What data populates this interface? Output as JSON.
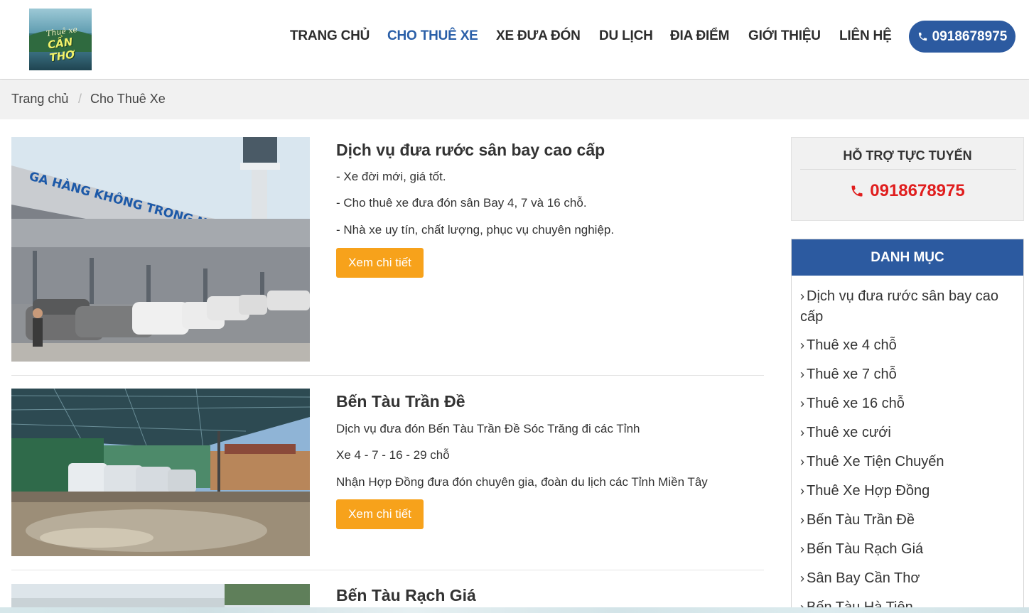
{
  "header": {
    "logo_text_line1": "Thuê xe",
    "logo_text_line2": "CẦN THƠ",
    "nav": [
      {
        "label": "TRANG CHỦ",
        "active": false
      },
      {
        "label": "CHO THUÊ XE",
        "active": true
      },
      {
        "label": "XE ĐƯA ĐÓN",
        "active": false
      },
      {
        "label": "DU LỊCH",
        "active": false
      },
      {
        "label": "ĐIA ĐIỂM",
        "active": false
      },
      {
        "label": "GIỚI THIỆU",
        "active": false
      },
      {
        "label": "LIÊN HỆ",
        "active": false
      }
    ],
    "phone": "0918678975"
  },
  "breadcrumb": {
    "home": "Trang chủ",
    "separator": "/",
    "current": "Cho Thuê Xe"
  },
  "articles": [
    {
      "title": "Dịch vụ đưa rước sân bay cao cấp",
      "lines": [
        "- Xe đời mới, giá tốt.",
        "- Cho thuê xe đưa đón sân Bay 4, 7 và 16 chỗ.",
        "- Nhà xe uy tín, chất lượng, phục vụ chuyên nghiệp."
      ],
      "button": "Xem chi tiết",
      "image_sign": "GA HÀNG KHÔNG TRONG NƯỚC"
    },
    {
      "title": "Bến Tàu Trần Đề",
      "lines": [
        "Dịch vụ đưa đón Bến Tàu Trần Đề Sóc Trăng đi các Tỉnh",
        "Xe 4 - 7 - 16 - 29 chỗ",
        "Nhận Hợp Đồng đưa đón chuyên gia, đoàn du lịch các Tỉnh Miền Tây"
      ],
      "button": "Xem chi tiết"
    },
    {
      "title": "Bến Tàu Rạch Giá"
    }
  ],
  "sidebar": {
    "support_title": "HỖ TRỢ TỰC TUYẾN",
    "support_phone": "0918678975",
    "category_title": "DANH MỤC",
    "categories": [
      "Dịch vụ đưa rước sân bay cao cấp",
      "Thuê xe 4 chỗ",
      "Thuê xe 7 chỗ",
      "Thuê xe 16 chỗ",
      "Thuê xe cưới",
      "Thuê Xe Tiện Chuyến",
      "Thuê Xe Hợp Đồng",
      "Bến Tàu Trần Đề",
      "Bến Tàu Rạch Giá",
      "Sân Bay Cần Thơ",
      "Bến Tàu Hà Tiên"
    ]
  },
  "colors": {
    "brand_blue": "#2c5aa0",
    "button_orange": "#f7a21b",
    "phone_red": "#e01e1e"
  }
}
